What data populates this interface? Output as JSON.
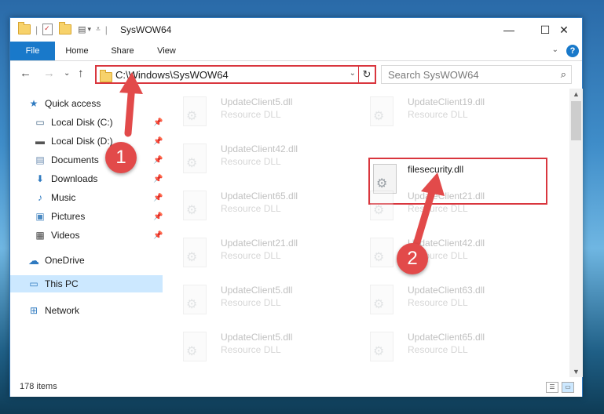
{
  "window": {
    "title": "SysWOW64",
    "controls": {
      "minimize": "—",
      "maximize": "☐",
      "close": "✕"
    }
  },
  "ribbon": {
    "tabs": [
      "File",
      "Home",
      "Share",
      "View"
    ],
    "help": "?"
  },
  "address_bar": {
    "path": "C:\\Windows\\SysWOW64",
    "refresh_glyph": "↻",
    "dropdown_glyph": "⌄"
  },
  "search": {
    "placeholder": "Search SysWOW64"
  },
  "nav": {
    "back": "←",
    "forward": "→",
    "recent": "⌄",
    "up": "↑"
  },
  "navpane": {
    "items": [
      {
        "label": "Quick access",
        "icon": "star-icon",
        "glyph": "★",
        "color": "#2f7ac0"
      },
      {
        "label": "Local Disk (C:)",
        "icon": "drive-icon",
        "glyph": "▭",
        "color": "#4a6b8a"
      },
      {
        "label": "Local Disk (D:)",
        "icon": "drive-icon",
        "glyph": "▬",
        "color": "#555555"
      },
      {
        "label": "Documents",
        "icon": "documents-icon",
        "glyph": "▤",
        "color": "#6b8bb0"
      },
      {
        "label": "Downloads",
        "icon": "downloads-icon",
        "glyph": "⬇",
        "color": "#2f7ac0"
      },
      {
        "label": "Music",
        "icon": "music-icon",
        "glyph": "♪",
        "color": "#2f7ac0"
      },
      {
        "label": "Pictures",
        "icon": "pictures-icon",
        "glyph": "▣",
        "color": "#4c8ac2"
      },
      {
        "label": "Videos",
        "icon": "videos-icon",
        "glyph": "▦",
        "color": "#444444"
      },
      {
        "label": "OneDrive",
        "icon": "onedrive-icon",
        "glyph": "☁",
        "color": "#2f7ac0"
      },
      {
        "label": "This PC",
        "icon": "computer-icon",
        "glyph": "▭",
        "color": "#2f7ac0"
      },
      {
        "label": "Network",
        "icon": "network-icon",
        "glyph": "⊞",
        "color": "#2f7ac0"
      }
    ]
  },
  "files": [
    {
      "name": "UpdateClient5.dll",
      "type": "Resource DLL"
    },
    {
      "name": "UpdateClient19.dll",
      "type": "Resource DLL"
    },
    {
      "name": "UpdateClient42.dll",
      "type": "Resource DLL"
    },
    {
      "name": "filesecurity.dll",
      "type": ""
    },
    {
      "name": "UpdateClient65.dll",
      "type": "Resource DLL"
    },
    {
      "name": "UpdateClient21.dll",
      "type": "Resource DLL"
    },
    {
      "name": "UpdateClient21.dll",
      "type": "Resource DLL"
    },
    {
      "name": "UpdateClient42.dll",
      "type": "Resource DLL"
    },
    {
      "name": "UpdateClient5.dll",
      "type": "Resource DLL"
    },
    {
      "name": "UpdateClient63.dll",
      "type": "Resource DLL"
    },
    {
      "name": "UpdateClient5.dll",
      "type": "Resource DLL"
    },
    {
      "name": "UpdateClient65.dll",
      "type": "Resource DLL"
    }
  ],
  "annotations": {
    "step1": "1",
    "step2": "2",
    "accent": "#d9363e"
  },
  "status": {
    "count": "178 items"
  },
  "colors": {
    "accent": "#1979ca",
    "selection": "#cce8ff",
    "highlight_box": "#d9363e"
  }
}
